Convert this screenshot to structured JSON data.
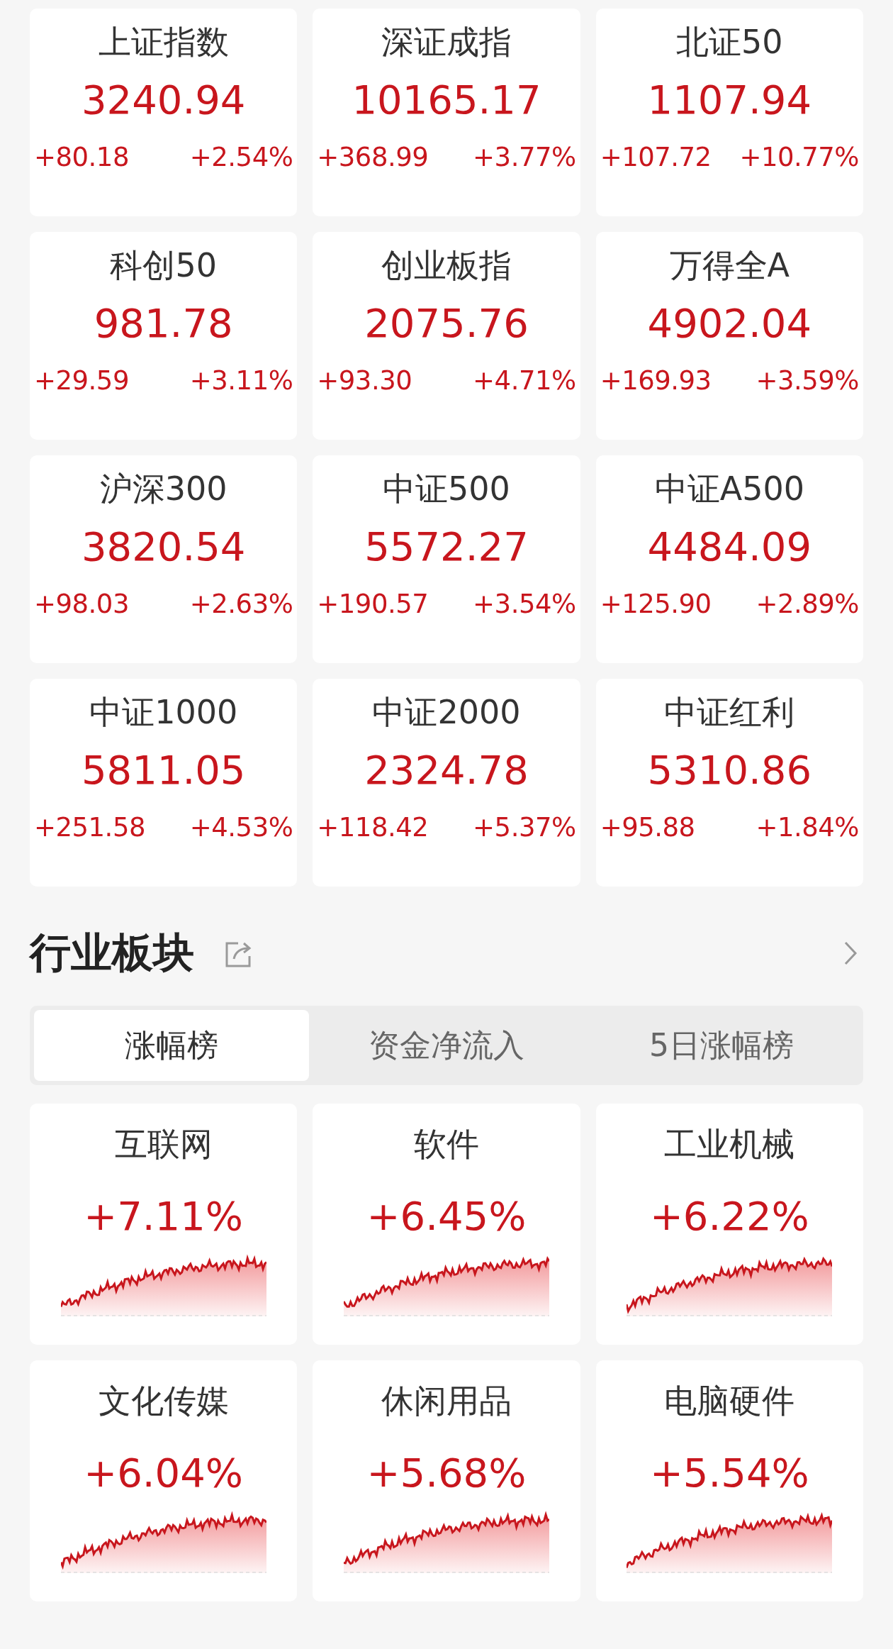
{
  "indices": [
    {
      "name": "上证指数",
      "value": "3240.94",
      "change": "+80.18",
      "percent": "+2.54%"
    },
    {
      "name": "深证成指",
      "value": "10165.17",
      "change": "+368.99",
      "percent": "+3.77%"
    },
    {
      "name": "北证50",
      "value": "1107.94",
      "change": "+107.72",
      "percent": "+10.77%"
    },
    {
      "name": "科创50",
      "value": "981.78",
      "change": "+29.59",
      "percent": "+3.11%"
    },
    {
      "name": "创业板指",
      "value": "2075.76",
      "change": "+93.30",
      "percent": "+4.71%"
    },
    {
      "name": "万得全A",
      "value": "4902.04",
      "change": "+169.93",
      "percent": "+3.59%"
    },
    {
      "name": "沪深300",
      "value": "3820.54",
      "change": "+98.03",
      "percent": "+2.63%"
    },
    {
      "name": "中证500",
      "value": "5572.27",
      "change": "+190.57",
      "percent": "+3.54%"
    },
    {
      "name": "中证A500",
      "value": "4484.09",
      "change": "+125.90",
      "percent": "+2.89%"
    },
    {
      "name": "中证1000",
      "value": "5811.05",
      "change": "+251.58",
      "percent": "+4.53%"
    },
    {
      "name": "中证2000",
      "value": "2324.78",
      "change": "+118.42",
      "percent": "+5.37%"
    },
    {
      "name": "中证红利",
      "value": "5310.86",
      "change": "+95.88",
      "percent": "+1.84%"
    }
  ],
  "section": {
    "title": "行业板块"
  },
  "tabs": [
    {
      "label": "涨幅榜",
      "selected": true
    },
    {
      "label": "资金净流入",
      "selected": false
    },
    {
      "label": "5日涨幅榜",
      "selected": false
    }
  ],
  "sectors": [
    {
      "name": "互联网",
      "percent": "+7.11%"
    },
    {
      "name": "软件",
      "percent": "+6.45%"
    },
    {
      "name": "工业机械",
      "percent": "+6.22%"
    },
    {
      "name": "文化传媒",
      "percent": "+6.04%"
    },
    {
      "name": "休闲用品",
      "percent": "+5.68%"
    },
    {
      "name": "电脑硬件",
      "percent": "+5.54%"
    }
  ]
}
